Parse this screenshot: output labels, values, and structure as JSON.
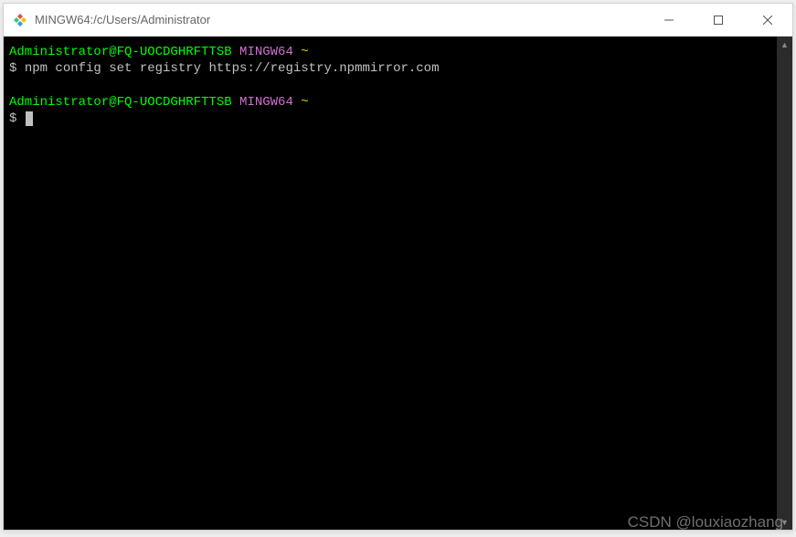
{
  "window": {
    "title": "MINGW64:/c/Users/Administrator"
  },
  "terminal": {
    "lines": [
      {
        "user_host": "Administrator@FQ-UOCDGHRFTTSB",
        "shell": "MINGW64",
        "path": "~"
      },
      {
        "prompt": "$",
        "command": "npm config set registry https://registry.npmmirror.com"
      },
      {
        "user_host": "Administrator@FQ-UOCDGHRFTTSB",
        "shell": "MINGW64",
        "path": "~"
      },
      {
        "prompt": "$",
        "command": ""
      }
    ]
  },
  "watermark": "CSDN @louxiaozhang"
}
